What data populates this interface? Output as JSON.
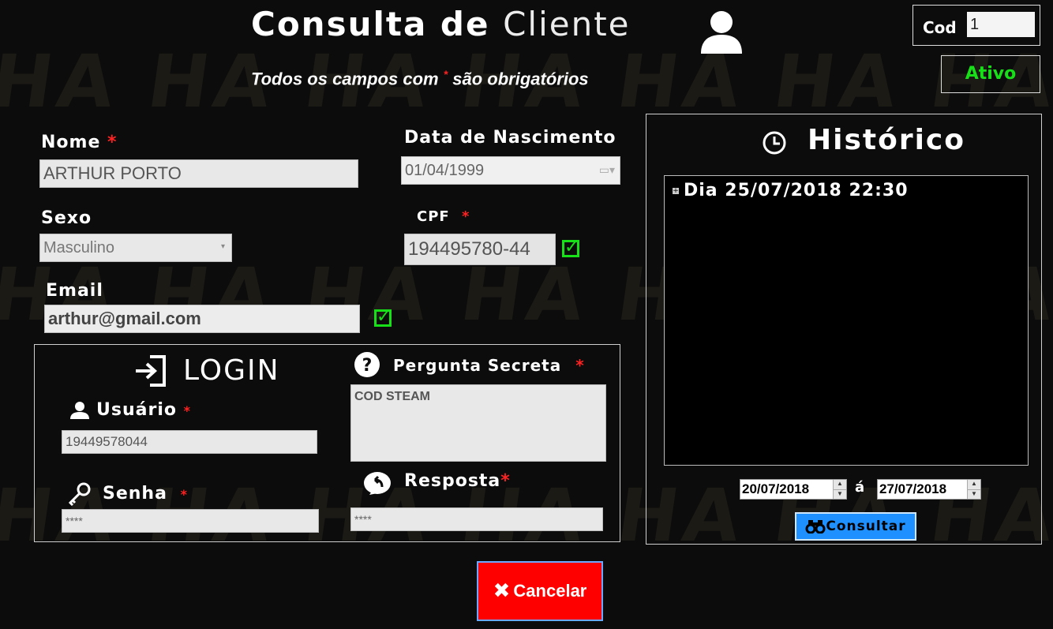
{
  "header": {
    "title_part1": "Consulta de",
    "title_part2": "Cliente",
    "subtitle_before": "Todos os campos com",
    "required_mark": "*",
    "subtitle_after": "são obrigatórios",
    "watermark": "HA"
  },
  "status": {
    "cod_label": "Cod",
    "cod_value": "1",
    "active_label": "Ativo",
    "active_color": "#18e018"
  },
  "form": {
    "nome": {
      "label": "Nome",
      "value": "ARTHUR PORTO"
    },
    "nascimento": {
      "label": "Data de Nascimento",
      "value": "01/04/1999"
    },
    "sexo": {
      "label": "Sexo",
      "value": "Masculino"
    },
    "cpf": {
      "label": "CPF",
      "value": "194495780-44"
    },
    "email": {
      "label": "Email",
      "value": "arthur@gmail.com"
    }
  },
  "login": {
    "title": "LOGIN",
    "usuario_label": "Usuário",
    "usuario_value": "19449578044",
    "senha_label": "Senha",
    "senha_value": "****",
    "pergunta_label": "Pergunta Secreta",
    "pergunta_value": "COD STEAM",
    "resposta_label": "Resposta",
    "resposta_value": "****"
  },
  "historico": {
    "title": "Histórico",
    "entries": [
      "Dia 25/07/2018 22:30"
    ],
    "date_from": "20/07/2018",
    "separator": "á",
    "date_to": "27/07/2018",
    "consultar_label": "Consultar"
  },
  "actions": {
    "cancel_label": "Cancelar",
    "cancel_color": "#ff0000"
  },
  "colors": {
    "background": "#0c0c0c",
    "required": "#ff2222",
    "check": "#18e018",
    "consultar_button": "#1e90ff"
  },
  "icons": [
    "user-icon",
    "login-icon",
    "question-icon",
    "usuario-icon",
    "key-icon",
    "reply-icon",
    "clock-icon",
    "expand-icon",
    "binoculars-icon",
    "close-icon",
    "check-icon",
    "calendar-icon",
    "dropdown-arrow-icon"
  ]
}
